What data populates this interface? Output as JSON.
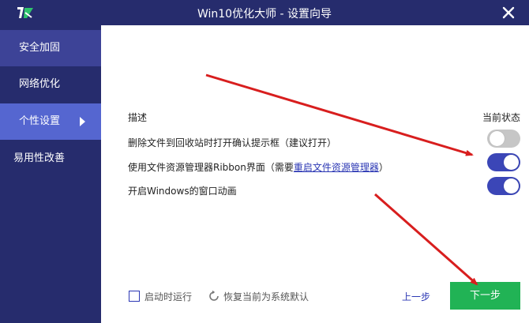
{
  "window": {
    "title": "Win10优化大师 - 设置向导",
    "close_icon": "close-icon",
    "logo_icon": "app-logo-icon"
  },
  "sidebar": {
    "items": [
      {
        "label": "安全加固",
        "active": false
      },
      {
        "label": "网络优化",
        "active": false
      },
      {
        "label": "个性设置",
        "active": true
      },
      {
        "label": "易用性改善",
        "active": false
      }
    ]
  },
  "settings": {
    "description_header": "描述",
    "status_header": "当前状态",
    "rows": [
      {
        "text": "删除文件到回收站时打开确认提示框（建议打开）",
        "enabled": false
      },
      {
        "text_before": "使用文件资源管理器Ribbon界面（需要",
        "link": "重启文件资源管理器",
        "text_after": "）",
        "enabled": true
      },
      {
        "text": "开启Windows的窗口动画",
        "enabled": true
      }
    ]
  },
  "footer": {
    "startup_label": "启动时运行",
    "restore_label": "恢复当前为系统默认",
    "prev_label": "上一步",
    "next_label": "下一步"
  },
  "colors": {
    "sidebar_bg": "#262c6d",
    "sidebar_alt": "#3d4397",
    "sidebar_active": "#5566d0",
    "toggle_on": "#3b46b7",
    "toggle_off": "#c6c6c6",
    "next_button": "#21b355",
    "annotation_arrow": "#d81e1e"
  }
}
